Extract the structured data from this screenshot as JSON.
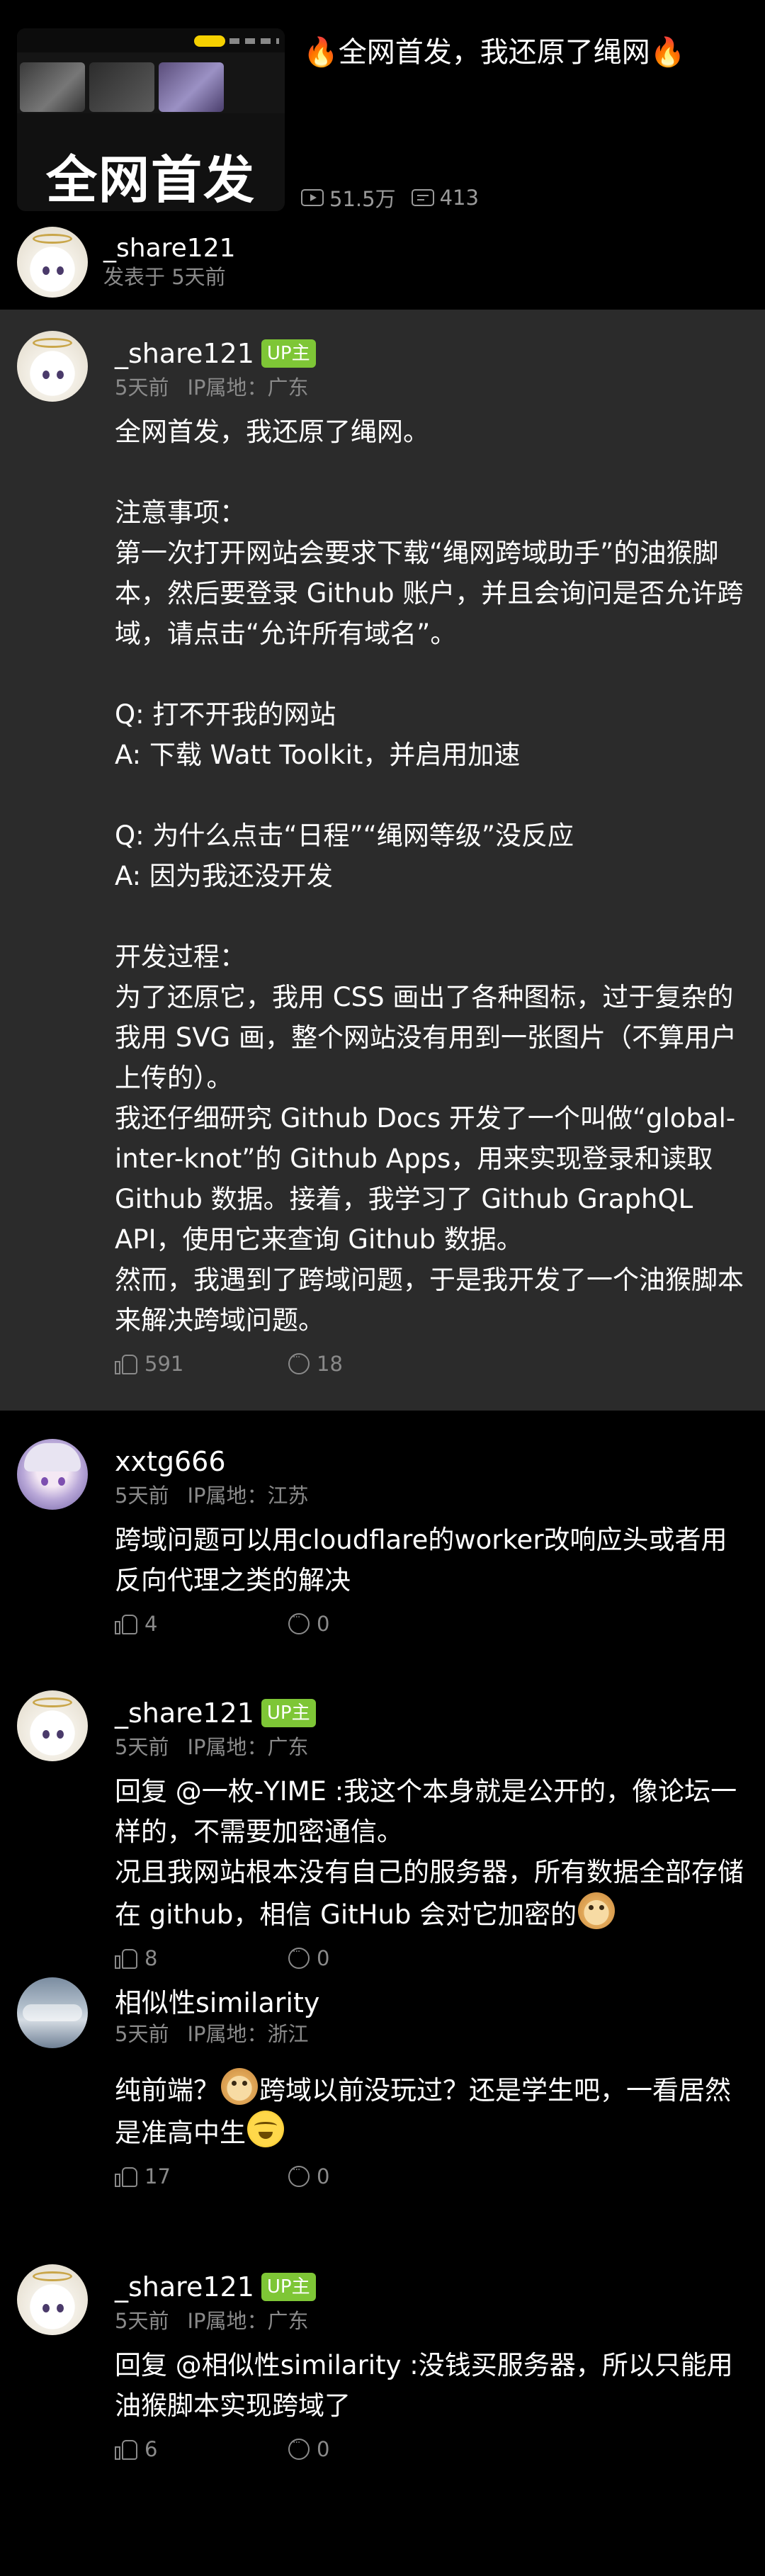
{
  "video": {
    "title": "🔥全网首发，我还原了绳网🔥",
    "thumb_text": "全网首发",
    "views": "51.5万",
    "danmaku": "413",
    "uploader_name": "_share121",
    "uploader_time": "发表于 5天前"
  },
  "comments": [
    {
      "user": "_share121",
      "up": "UP主",
      "time": "5天前",
      "ip": "IP属地：广东",
      "text": "全网首发，我还原了绳网。\n\n注意事项：\n第一次打开网站会要求下载“绳网跨域助手”的油猴脚本，然后要登录 Github 账户，并且会询问是否允许跨域，请点击“允许所有域名”。\n\nQ: 打不开我的网站\nA: 下载 Watt Toolkit，并启用加速\n\nQ: 为什么点击“日程”“绳网等级”没反应\nA: 因为我还没开发\n\n开发过程：\n为了还原它，我用 CSS 画出了各种图标，过于复杂的我用 SVG 画，整个网站没有用到一张图片（不算用户上传的）。\n我还仔细研究 Github Docs 开发了一个叫做“global-inter-knot”的 Github Apps，用来实现登录和读取 Github 数据。接着，我学习了 Github GraphQL API，使用它来查询 Github 数据。\n然而，我遇到了跨域问题，于是我开发了一个油猴脚本来解决跨域问题。",
      "likes": "591",
      "replies": "18"
    },
    {
      "user": "xxtg666",
      "time": "5天前",
      "ip": "IP属地：江苏",
      "text": "跨域问题可以用cloudflare的worker改响应头或者用反向代理之类的解决",
      "likes": "4",
      "replies": "0"
    },
    {
      "user": "_share121",
      "up": "UP主",
      "time": "5天前",
      "ip": "IP属地：广东",
      "text_a": "回复 @一枚-YIME :我这个本身就是公开的，像论坛一样的，不需要加密通信。\n况且我网站根本没有自己的服务器，所有数据全部存储在 github，相信 GitHub 会对它加密的",
      "emoji_a": "doge-emoji",
      "likes": "8",
      "replies": "0"
    },
    {
      "user": "相似性similarity",
      "time": "5天前",
      "ip": "IP属地：浙江",
      "text_a": "纯前端？",
      "emoji_a": "doge-emoji",
      "text_b": "跨域以前没玩过？还是学生吧，一看居然是准高中生",
      "emoji_b": "cry-laugh-emoji",
      "likes": "17",
      "replies": "0"
    },
    {
      "user": "_share121",
      "up": "UP主",
      "time": "5天前",
      "ip": "IP属地：广东",
      "text": "回复 @相似性similarity :没钱买服务器，所以只能用油猴脚本实现跨域了",
      "likes": "6",
      "replies": "0"
    }
  ]
}
